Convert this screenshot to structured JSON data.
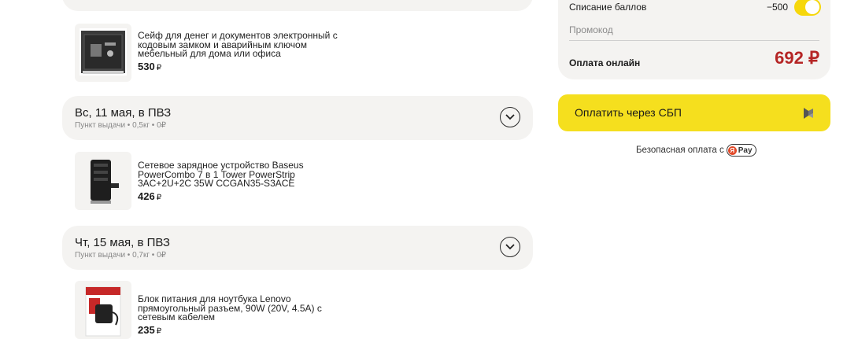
{
  "items": [
    {
      "name": "Сейф для денег и документов электронный с кодовым замком и аварийным ключом мебельный для дома или офиса",
      "price": "530",
      "currency": "₽"
    },
    {
      "name": "Сетевое зарядное устройство Baseus PowerCombo 7 в 1 Tower PowerStrip 3AC+2U+2C 35W CCGAN35-S3ACE",
      "price": "426",
      "currency": "₽"
    },
    {
      "name": "Блок питания для ноутбука Lenovo прямоугольный разъем, 90W (20V, 4.5A) с сетевым кабелем",
      "price": "235",
      "currency": "₽"
    }
  ],
  "groups": [
    {
      "title": "Вс, 11 мая, в ПВЗ",
      "subtitle": "Пункт выдачи • 0,5кг • 0₽"
    },
    {
      "title": "Чт, 15 мая, в ПВЗ",
      "subtitle": "Пункт выдачи • 0,7кг • 0₽"
    }
  ],
  "summary": {
    "bonus_label": "Списание баллов",
    "bonus_value": "−500",
    "bonus_enabled": true,
    "promo_placeholder": "Промокод",
    "pay_label": "Оплата онлайн",
    "total": "692 ₽"
  },
  "pay_button": {
    "label": "Оплатить через СБП",
    "icon": "sbp-icon"
  },
  "secure_note": {
    "text": "Безопасная оплата с",
    "badge": "Pay",
    "badge_icon": "yandex-pay-icon"
  },
  "colors": {
    "accent": "#f5df1e",
    "total": "#b52525",
    "card_bg": "#f4f3f1",
    "toggle": "#f6d70b"
  }
}
